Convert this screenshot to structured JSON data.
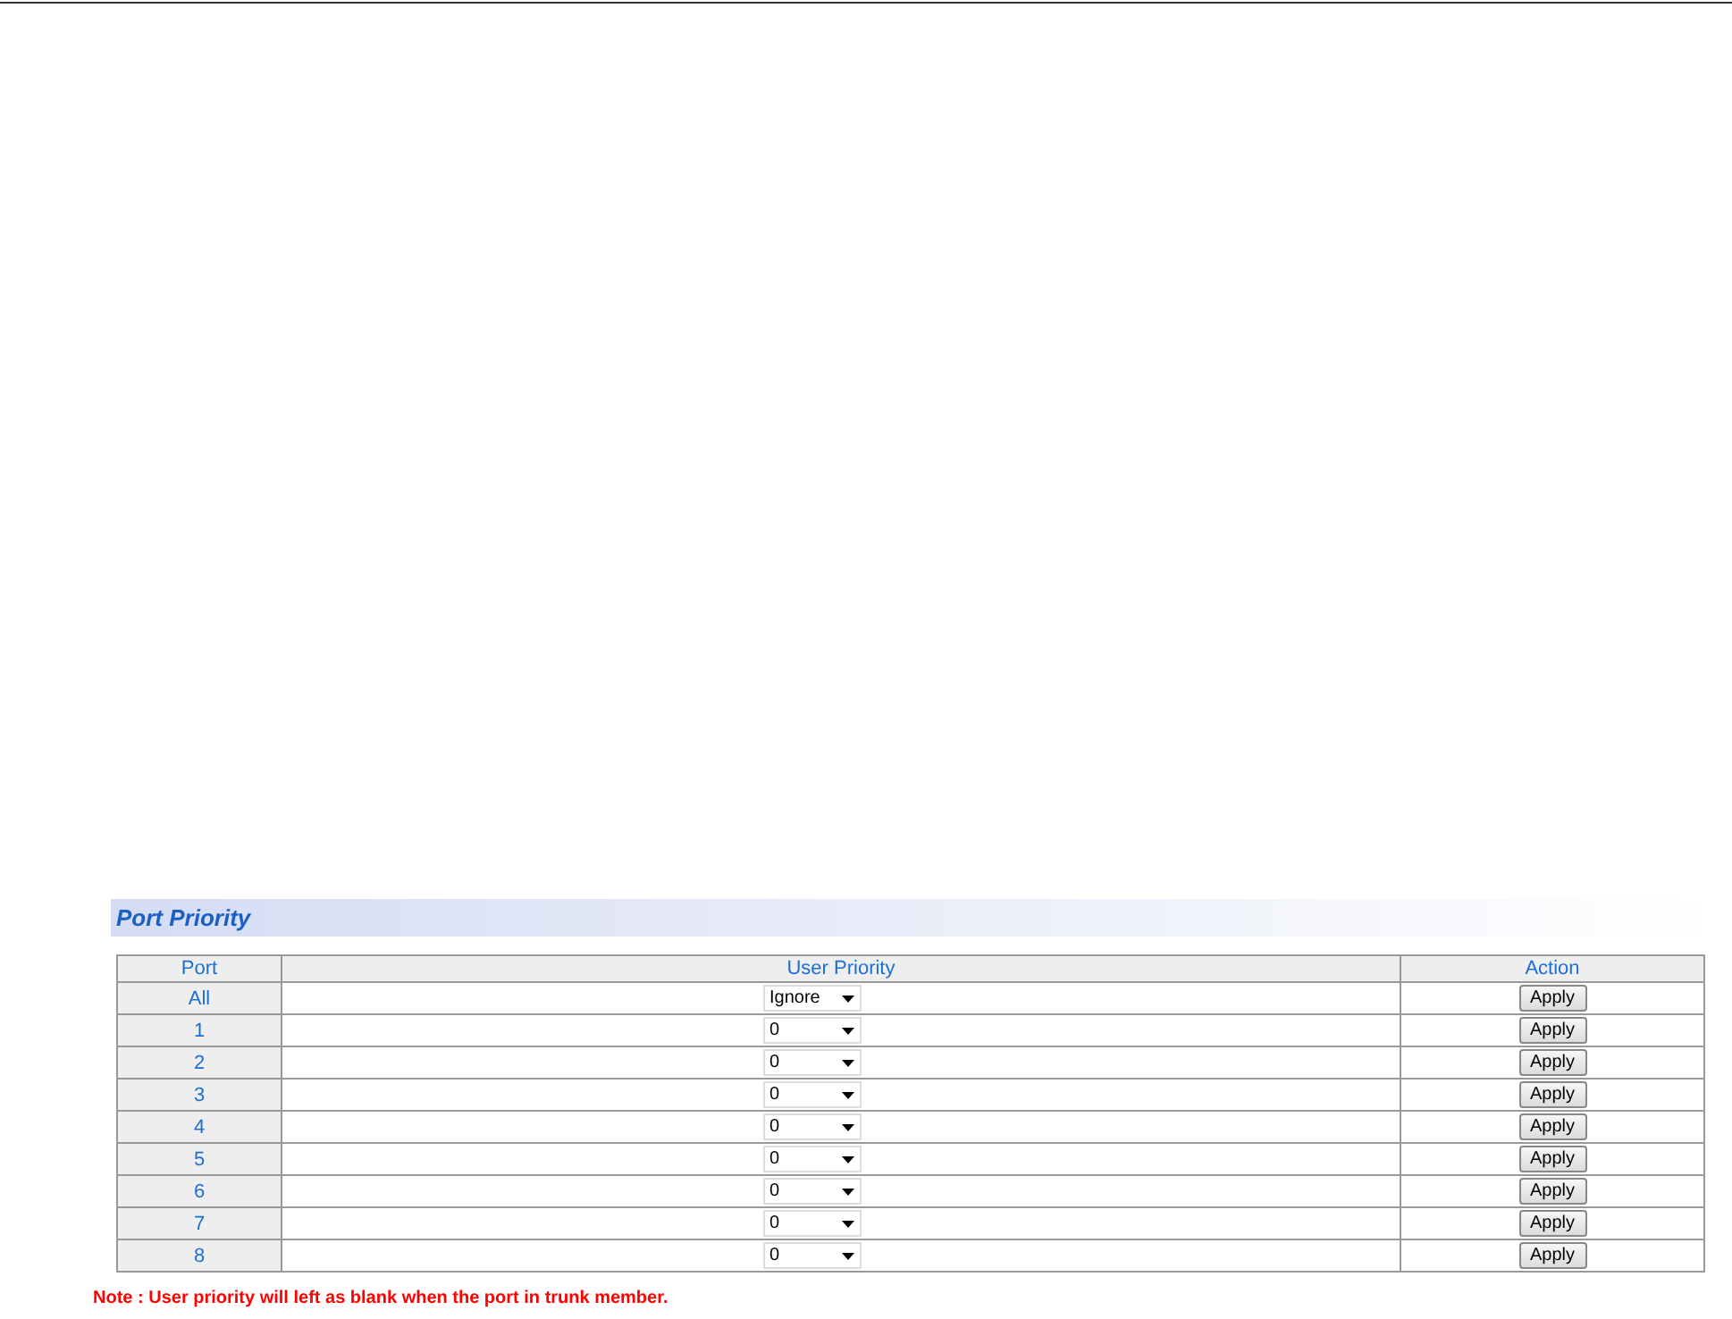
{
  "section": {
    "title": "Port Priority"
  },
  "table": {
    "columns": [
      "Port",
      "User Priority",
      "Action"
    ],
    "rows": [
      {
        "port": "All",
        "priority": "Ignore",
        "action": "Apply"
      },
      {
        "port": "1",
        "priority": "0",
        "action": "Apply"
      },
      {
        "port": "2",
        "priority": "0",
        "action": "Apply"
      },
      {
        "port": "3",
        "priority": "0",
        "action": "Apply"
      },
      {
        "port": "4",
        "priority": "0",
        "action": "Apply"
      },
      {
        "port": "5",
        "priority": "0",
        "action": "Apply"
      },
      {
        "port": "6",
        "priority": "0",
        "action": "Apply"
      },
      {
        "port": "7",
        "priority": "0",
        "action": "Apply"
      },
      {
        "port": "8",
        "priority": "0",
        "action": "Apply"
      }
    ]
  },
  "note": "Note : User priority will left as blank when the port in trunk member."
}
